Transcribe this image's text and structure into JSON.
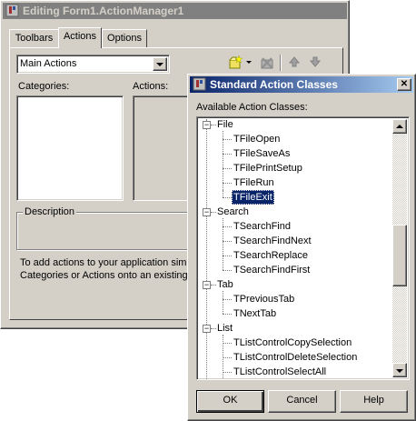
{
  "background_window": {
    "title": "Editing Form1.ActionManager1",
    "tabs": [
      "Toolbars",
      "Actions",
      "Options"
    ],
    "active_tab": "Actions",
    "combo_value": "Main Actions",
    "categories_label": "Categories:",
    "actions_label": "Actions:",
    "description_label": "Description",
    "hint_line1": "To add actions to your application simp",
    "hint_line2": "Categories or Actions onto an existing"
  },
  "dialog": {
    "title": "Standard Action Classes",
    "close_glyph": "✕",
    "list_label": "Available Action Classes:",
    "tree": [
      {
        "group": "File",
        "items": [
          "TFileOpen",
          "TFileSaveAs",
          "TFilePrintSetup",
          "TFileRun",
          "TFileExit"
        ]
      },
      {
        "group": "Search",
        "items": [
          "TSearchFind",
          "TSearchFindNext",
          "TSearchReplace",
          "TSearchFindFirst"
        ]
      },
      {
        "group": "Tab",
        "items": [
          "TPreviousTab",
          "TNextTab"
        ]
      },
      {
        "group": "List",
        "items": [
          "TListControlCopySelection",
          "TListControlDeleteSelection",
          "TListControlSelectAll"
        ]
      }
    ],
    "selected_item": "TFileExit",
    "buttons": {
      "ok": "OK",
      "cancel": "Cancel",
      "help": "Help"
    }
  },
  "colors": {
    "title_active_start": "#0a246a",
    "title_active_end": "#a6caf0",
    "face": "#d4d0c8",
    "selection": "#0a246a"
  },
  "icons": [
    "app-icon",
    "new-action-icon",
    "dropdown-arrow-icon",
    "delete-action-icon",
    "move-up-icon",
    "move-down-icon",
    "close-icon",
    "scroll-up-icon",
    "scroll-down-icon",
    "expand-minus-icon"
  ]
}
